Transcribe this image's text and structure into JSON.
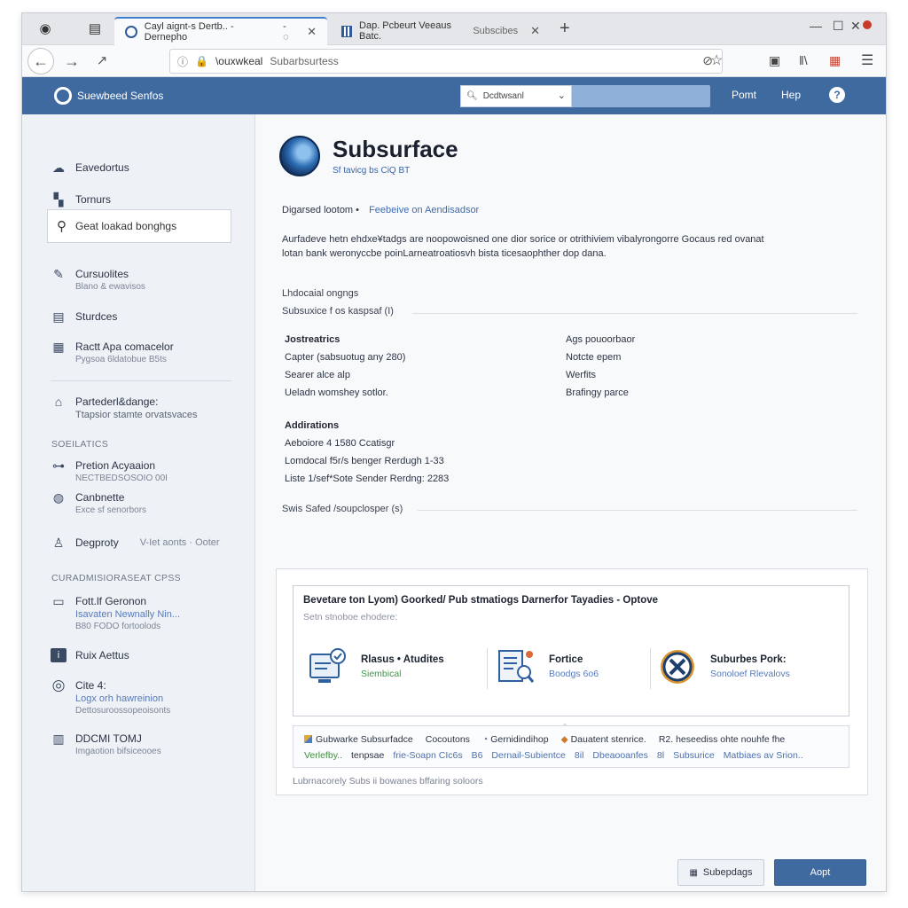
{
  "browser": {
    "tabs": [
      {
        "label": "Cayl aignt-s Dertb.. - Dernepho"
      },
      {
        "label": "Dap. Pcbeurt Veeaus Batc."
      },
      {
        "label": "Subscibes"
      }
    ],
    "tab_extra": "- ◌",
    "url_prefix": "\\ouxwkeal",
    "url_path": "Subarbsurtess"
  },
  "app": {
    "brand": "Suewbeed Senfos",
    "search_placeholder": "Dcdtwsanl",
    "links": [
      "Pomt",
      "Hep"
    ]
  },
  "sidebar": {
    "top_items": [
      {
        "label": "Eavedortus",
        "icon": "cloud-icon"
      },
      {
        "label": "Tornurs",
        "icon": "grid-icon"
      }
    ],
    "search_text": "Geat loakad bonghgs",
    "items": [
      {
        "label": "Cursuolites",
        "sub": "Blano & ewavisos"
      },
      {
        "label": "Sturdces",
        "sub": ""
      },
      {
        "label": "Ractt Apa comacelor",
        "sub": "Pygsoa 6ldatobue B5ts"
      }
    ],
    "group2": {
      "label": "Partederl&dange:",
      "sub": "Ttapsior stamte orvatsvaces"
    },
    "section1": "SOEILATICS",
    "section1_items": [
      {
        "label": "Pretion Acyaaion",
        "sub": "NECTBEDSOSOIO 00I"
      },
      {
        "label": "Canbnette",
        "sub": "Exce sf senorbors"
      },
      {
        "label": "Degproty",
        "sub": "V-Iet aonts  · Ooter"
      }
    ],
    "section2": "CURADMISIORASEAT CPSS",
    "section2_items": [
      {
        "label": "Fott.lf Geronon",
        "sub": "Isavaten Newnally Nin...",
        "sub2": "B80 FODO fortoolods"
      },
      {
        "label": "Ruix Aettus",
        "sub": ""
      },
      {
        "label": "Cite 4:",
        "sub": "Logx orh hawreinion",
        "sub2": "Dettosuroossopeoisonts"
      },
      {
        "label": "DDCMI TOMJ",
        "sub": "Imgaotion bifsiceooes"
      }
    ]
  },
  "main": {
    "title": "Subsurface",
    "subtitle": "Sf tavicg bs CiQ BT",
    "meta": "Digarsed lootom  •",
    "meta_link": "Feebeive on Aendisadsor",
    "desc": "Aurfadeve hetn ehdxe¥tadgs are noopowoisned one dior sorice or otrithiviem vibalyrongorre Gocaus red ovanat lotan bank weronyccbe poinLarneatroatiosvh bista ticesaophther dop dana.",
    "section_a": "Lhdocaial ongngs",
    "section_b": "Subsuxice f os kaspsaf (I)",
    "left_col_title": "Jostreatrics",
    "left_col": [
      "Capter (sabsuotug any 280)",
      "Searer alce alp",
      "Ueladn womshey sotlor."
    ],
    "right_col": [
      "Ags pouoorbaor",
      "Notcte epem",
      "Werfits",
      "Brafingy parce"
    ],
    "add_title": "Addirations",
    "add_rows": [
      "Aeboiore 4 1580 Ccatisgr",
      "Lomdocal f5r/s benger Rerdugh 1-33",
      "Liste 1/sef*Sote Sender Rerdng: 2283"
    ],
    "swatch_line": "Swis Safed /soupclosper (s)"
  },
  "card": {
    "title": "Bevetare ton Lyom) Goorked/ Pub stmatiogs Darnerfor Tayadies - Optove",
    "subtitle": "Setn stnoboe ehodere:",
    "features": [
      {
        "title": "Rlasus • Atudites",
        "sub": "Siembical",
        "icon": "dashboard-icon"
      },
      {
        "title": "Fortice",
        "sub": "Boodgs 6o6",
        "icon": "document-search-icon"
      },
      {
        "title": "Suburbes Pork:",
        "sub": "Sonoloef Rlevalovs",
        "icon": "gear-tools-icon"
      }
    ],
    "tags_row1": [
      "Gubwarke Subsurfadce",
      "Cocoutons",
      "Gernidindihop",
      "Dauatent stenrice.",
      "R2.  heseediss ohte nouhfe fhe"
    ],
    "tags_row2_lead": "Verlefby..",
    "tags_row2": [
      "tenpsae",
      "frie-Soapn CIc6s",
      "B6",
      "Dernail-Subientce",
      "8il",
      "Dbeaooanfes",
      "8l",
      "Subsurice",
      "Matbiaes av Srion.."
    ],
    "footer": "Lubrnacorely Subs ii bowanes bffaring soloors"
  },
  "buttons": {
    "secondary": "Subepdags",
    "primary": "Aopt"
  },
  "colors": {
    "accent": "#3e6aa0",
    "link": "#3d6cb5",
    "green": "#3e9a4a"
  }
}
